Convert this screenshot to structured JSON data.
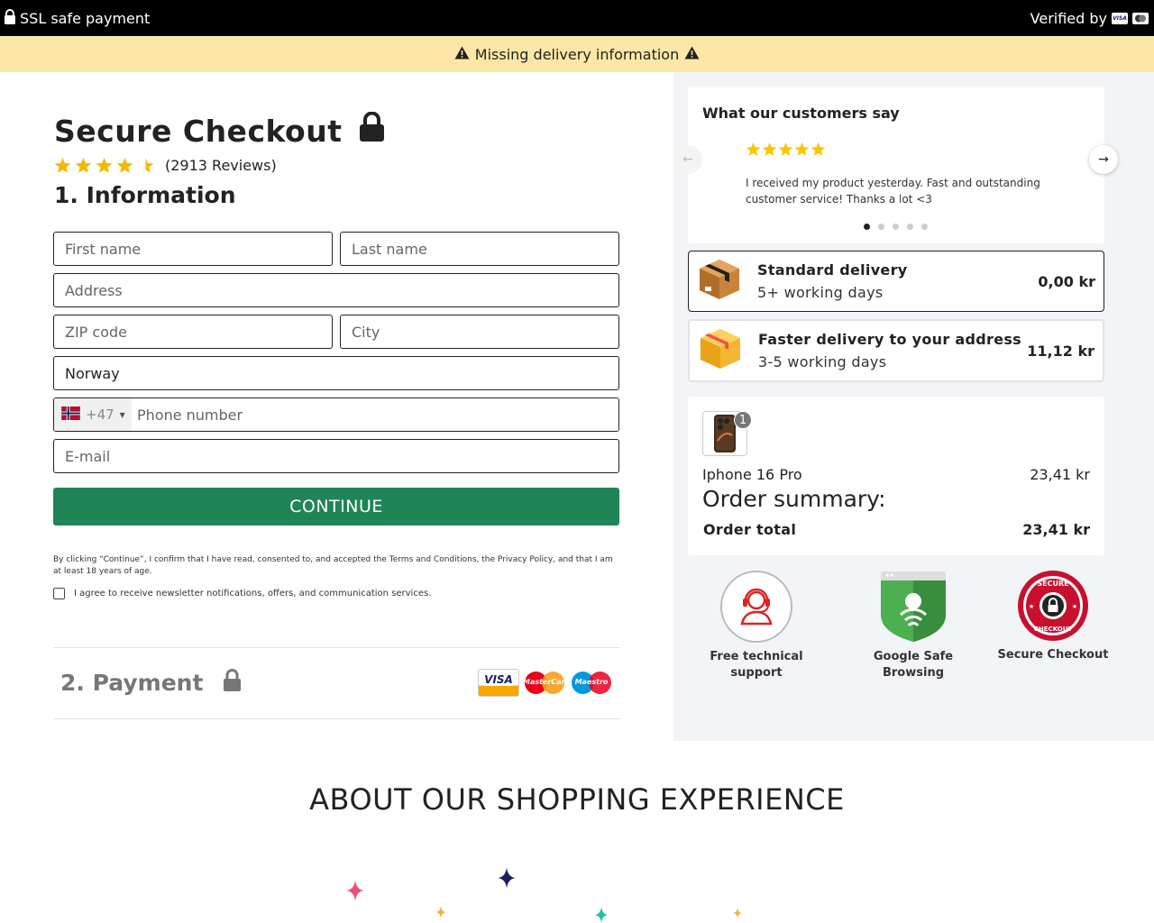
{
  "topbar": {
    "left_label": "SSL safe payment",
    "right_label": "Verified by",
    "card_mark": "VISA"
  },
  "warning": {
    "text": "Missing delivery information"
  },
  "checkout": {
    "title": "Secure Checkout",
    "rating_value": 4.5,
    "reviews_label": "(2913 Reviews)",
    "step1_title": "1. Information",
    "fields": {
      "first_name": "First name",
      "last_name": "Last name",
      "address": "Address",
      "zip": "ZIP code",
      "city": "City",
      "country": "Norway",
      "phone_prefix": "+47",
      "phone": "Phone number",
      "email": "E-mail"
    },
    "continue_label": "CONTINUE",
    "legal_text": "By clicking “Continue”, I confirm that I have read, consented to, and accepted the Terms and Conditions, the Privacy Policy, and that I am at least 18 years of age.",
    "newsletter_label": "I agree to receive newsletter notifications, offers, and communication services.",
    "step2_title": "2. Payment",
    "payment_cards": {
      "visa": "VISA",
      "mastercard": "MasterCard",
      "maestro": "Maestro"
    }
  },
  "reviews": {
    "title": "What our customers say",
    "stars": 5,
    "text": "I received my product yesterday. Fast and outstanding customer service! Thanks a lot <3",
    "slide_count": 5,
    "active_slide": 1
  },
  "delivery": [
    {
      "name": "Standard delivery",
      "days": "5+ working days",
      "price": "0,00 kr",
      "selected": true
    },
    {
      "name": "Faster delivery to your address",
      "days": "3-5 working days",
      "price": "11,12 kr",
      "selected": false
    }
  ],
  "order": {
    "item_name": "Iphone 16 Pro",
    "item_qty": "1",
    "item_price": "23,41 kr",
    "summary_title": "Order summary:",
    "total_label": "Order total",
    "total_value": "23,41 kr"
  },
  "trust": {
    "support": "Free technical support",
    "google": "Google Safe Browsing",
    "secure": "Secure Checkout",
    "seal_top": "SECURE",
    "seal_bottom": "CHECKOUT"
  },
  "about": {
    "title": "ABOUT OUR SHOPPING EXPERIENCE"
  },
  "colors": {
    "accent_green": "#1f8456",
    "warning_bg": "#fde7a6",
    "star": "#f5b800",
    "topbar_bg": "#000000"
  }
}
